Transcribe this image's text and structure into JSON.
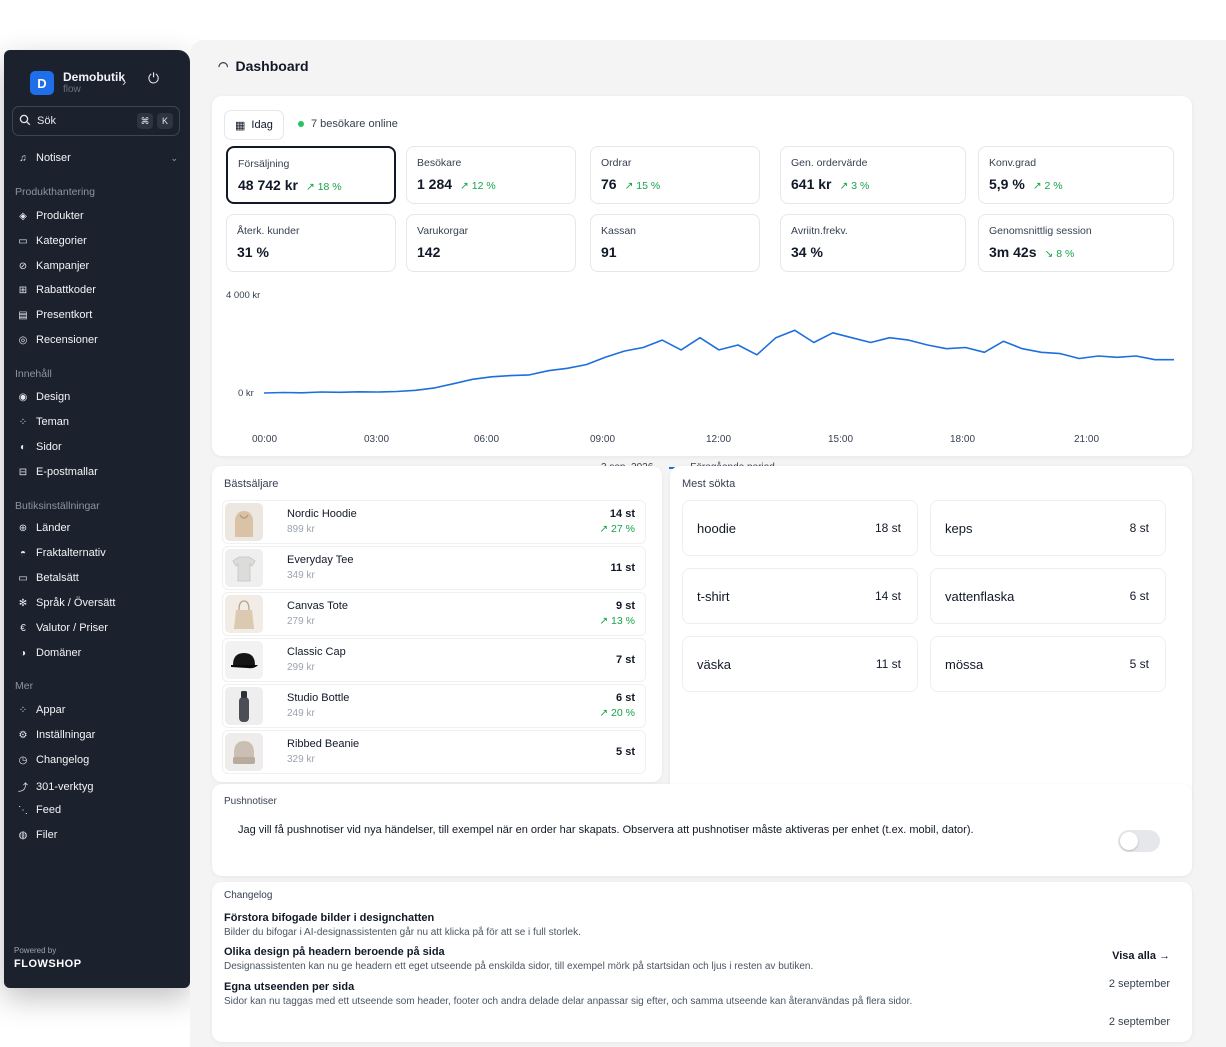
{
  "sidebar": {
    "brand": {
      "initial": "D",
      "name": "Demobutik",
      "sub": "flow"
    },
    "search": {
      "label": "Sök",
      "shortcut_1": "⌘",
      "shortcut_2": "K"
    },
    "notiser": "Notiser",
    "groups": {
      "produkthantering": "Produkthantering",
      "innehall": "Innehåll",
      "butiksinstallningar": "Butiksinställningar",
      "mer": "Mer"
    },
    "items": {
      "produkter": "Produkter",
      "kategorier": "Kategorier",
      "kampanjer": "Kampanjer",
      "rabattkoder": "Rabattkoder",
      "presentkort": "Presentkort",
      "recensioner": "Recensioner",
      "design": "Design",
      "teman": "Teman",
      "sidor": "Sidor",
      "epostmallar": "E-postmallar",
      "lander": "Länder",
      "fraktalternativ": "Fraktalternativ",
      "betalsatt": "Betalsätt",
      "sprak": "Språk / Översätt",
      "valutor": "Valutor / Priser",
      "domaner": "Domäner",
      "appar": "Appar",
      "installningar": "Inställningar",
      "changelog": "Changelog",
      "verktyg301": "301-verktyg",
      "feed": "Feed",
      "filer": "Filer"
    },
    "powered_by": "Powered by",
    "logo": "FLOWSHOP"
  },
  "header": {
    "title": "Dashboard"
  },
  "overview": {
    "date_button": "Idag",
    "online_text": "7 besökare online",
    "metrics": [
      {
        "label": "Försäljning",
        "value": "48 742 kr",
        "trend": "↗ 18 %"
      },
      {
        "label": "Besökare",
        "value": "1 284",
        "trend": "↗ 12 %"
      },
      {
        "label": "Ordrar",
        "value": "76",
        "trend": "↗ 15 %"
      },
      {
        "label": "Gen. ordervärde",
        "value": "641 kr",
        "trend": "↗ 3 %"
      },
      {
        "label": "Konv.grad",
        "value": "5,9 %",
        "trend": "↗ 2 %"
      },
      {
        "label": "Återk. kunder",
        "value": "31 %",
        "trend": ""
      },
      {
        "label": "Varukorgar",
        "value": "142",
        "trend": ""
      },
      {
        "label": "Kassan",
        "value": "91",
        "trend": ""
      },
      {
        "label": "Avriitn.frekv.",
        "value": "34 %",
        "trend": ""
      },
      {
        "label": "Genomsnittlig session",
        "value": "3m 42s",
        "trend": "↘ 8 %"
      }
    ]
  },
  "chart_data": {
    "type": "line",
    "y_ticks": [
      "4 000 kr",
      "0 kr"
    ],
    "ylim": [
      0,
      4000
    ],
    "x_ticks": [
      "00:00",
      "03:00",
      "06:00",
      "09:00",
      "12:00",
      "15:00",
      "18:00",
      "21:00"
    ],
    "xlim": [
      0,
      24
    ],
    "series": [
      {
        "name": "3 sep. 2026",
        "style": "solid",
        "x": [
          0,
          0.5,
          1,
          1.5,
          2,
          2.5,
          3,
          3.5,
          4,
          4.5,
          5,
          5.5,
          6,
          6.5,
          7,
          7.5,
          8,
          8.5,
          9,
          9.5,
          10,
          10.5,
          11,
          11.5,
          12,
          12.5,
          13,
          13.5,
          14,
          14.5,
          15,
          15.5,
          16,
          16.5,
          17,
          17.5,
          18,
          18.5,
          19,
          19.5,
          20,
          20.5,
          21,
          21.5,
          22,
          22.5,
          23,
          23.5,
          24
        ],
        "y": [
          40,
          60,
          50,
          80,
          70,
          90,
          80,
          100,
          150,
          250,
          420,
          600,
          700,
          750,
          780,
          950,
          1050,
          1200,
          1500,
          1750,
          1900,
          2200,
          1800,
          2300,
          1800,
          2000,
          1600,
          2300,
          2600,
          2100,
          2500,
          2300,
          2100,
          2300,
          2200,
          2000,
          1850,
          1900,
          1700,
          2150,
          1850,
          1700,
          1650,
          1450,
          1550,
          1500,
          1550,
          1400,
          1400
        ]
      }
    ],
    "legend": [
      "3 sep. 2026",
      "Föregående period"
    ],
    "grid": false,
    "legend_position": "bottom"
  },
  "bestsellers": {
    "title": "Bästsäljare",
    "items": [
      {
        "name": "Nordic Hoodie",
        "price": "899 kr",
        "qty": "14 st",
        "trend": "↗ 27 %"
      },
      {
        "name": "Everyday Tee",
        "price": "349 kr",
        "qty": "11 st",
        "trend": ""
      },
      {
        "name": "Canvas Tote",
        "price": "279 kr",
        "qty": "9 st",
        "trend": "↗ 13 %"
      },
      {
        "name": "Classic Cap",
        "price": "299 kr",
        "qty": "7 st",
        "trend": ""
      },
      {
        "name": "Studio Bottle",
        "price": "249 kr",
        "qty": "6 st",
        "trend": "↗ 20 %"
      },
      {
        "name": "Ribbed Beanie",
        "price": "329 kr",
        "qty": "5 st",
        "trend": ""
      }
    ]
  },
  "mest_sokta": {
    "title": "Mest sökta",
    "items": [
      {
        "term": "hoodie",
        "count": "18 st"
      },
      {
        "term": "keps",
        "count": "8 st"
      },
      {
        "term": "t-shirt",
        "count": "14 st"
      },
      {
        "term": "vattenflaska",
        "count": "6 st"
      },
      {
        "term": "väska",
        "count": "11 st"
      },
      {
        "term": "mössa",
        "count": "5 st"
      }
    ]
  },
  "pushnotiser": {
    "title": "Pushnotiser",
    "text": "Jag vill få pushnotiser vid nya händelser, till exempel när en order har skapats. Observera att pushnotiser måste aktiveras per enhet (t.ex. mobil, dator).",
    "enabled": false
  },
  "changelog": {
    "title": "Changelog",
    "visa_alla": "Visa alla →",
    "entries": [
      {
        "title": "Förstora bifogade bilder i designchatten",
        "desc": "Bilder du bifogar i AI-designassistenten går nu att klicka på för att se i full storlek.",
        "date": ""
      },
      {
        "title": "Olika design på headern beroende på sida",
        "desc": "Designassistenten kan nu ge headern ett eget utseende på enskilda sidor, till exempel mörk på startsidan och ljus i resten av butiken.",
        "date": "2 september"
      },
      {
        "title": "Egna utseenden per sida",
        "desc": "Sidor kan nu taggas med ett utseende som header, footer och andra delade delar anpassar sig efter, och samma utseende kan återanvändas på flera sidor.",
        "date": "2 september"
      }
    ],
    "extra_date": "2 september"
  },
  "colors": {
    "sidebar": "#1b222d",
    "accent": "#1d6fdc",
    "positive": "#16a34a",
    "brand_avatar": "#1f6feb"
  }
}
